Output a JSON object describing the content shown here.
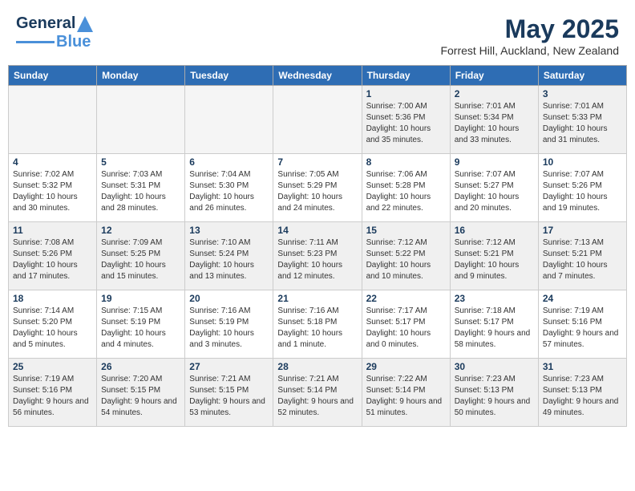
{
  "header": {
    "logo_line1": "General",
    "logo_line2": "Blue",
    "title": "May 2025",
    "subtitle": "Forrest Hill, Auckland, New Zealand"
  },
  "days_of_week": [
    "Sunday",
    "Monday",
    "Tuesday",
    "Wednesday",
    "Thursday",
    "Friday",
    "Saturday"
  ],
  "weeks": [
    [
      {
        "day": "",
        "empty": true
      },
      {
        "day": "",
        "empty": true
      },
      {
        "day": "",
        "empty": true
      },
      {
        "day": "",
        "empty": true
      },
      {
        "day": "1",
        "sunrise": "7:00 AM",
        "sunset": "5:36 PM",
        "daylight": "10 hours and 35 minutes."
      },
      {
        "day": "2",
        "sunrise": "7:01 AM",
        "sunset": "5:34 PM",
        "daylight": "10 hours and 33 minutes."
      },
      {
        "day": "3",
        "sunrise": "7:01 AM",
        "sunset": "5:33 PM",
        "daylight": "10 hours and 31 minutes."
      }
    ],
    [
      {
        "day": "4",
        "sunrise": "7:02 AM",
        "sunset": "5:32 PM",
        "daylight": "10 hours and 30 minutes."
      },
      {
        "day": "5",
        "sunrise": "7:03 AM",
        "sunset": "5:31 PM",
        "daylight": "10 hours and 28 minutes."
      },
      {
        "day": "6",
        "sunrise": "7:04 AM",
        "sunset": "5:30 PM",
        "daylight": "10 hours and 26 minutes."
      },
      {
        "day": "7",
        "sunrise": "7:05 AM",
        "sunset": "5:29 PM",
        "daylight": "10 hours and 24 minutes."
      },
      {
        "day": "8",
        "sunrise": "7:06 AM",
        "sunset": "5:28 PM",
        "daylight": "10 hours and 22 minutes."
      },
      {
        "day": "9",
        "sunrise": "7:07 AM",
        "sunset": "5:27 PM",
        "daylight": "10 hours and 20 minutes."
      },
      {
        "day": "10",
        "sunrise": "7:07 AM",
        "sunset": "5:26 PM",
        "daylight": "10 hours and 19 minutes."
      }
    ],
    [
      {
        "day": "11",
        "sunrise": "7:08 AM",
        "sunset": "5:26 PM",
        "daylight": "10 hours and 17 minutes."
      },
      {
        "day": "12",
        "sunrise": "7:09 AM",
        "sunset": "5:25 PM",
        "daylight": "10 hours and 15 minutes."
      },
      {
        "day": "13",
        "sunrise": "7:10 AM",
        "sunset": "5:24 PM",
        "daylight": "10 hours and 13 minutes."
      },
      {
        "day": "14",
        "sunrise": "7:11 AM",
        "sunset": "5:23 PM",
        "daylight": "10 hours and 12 minutes."
      },
      {
        "day": "15",
        "sunrise": "7:12 AM",
        "sunset": "5:22 PM",
        "daylight": "10 hours and 10 minutes."
      },
      {
        "day": "16",
        "sunrise": "7:12 AM",
        "sunset": "5:21 PM",
        "daylight": "10 hours and 9 minutes."
      },
      {
        "day": "17",
        "sunrise": "7:13 AM",
        "sunset": "5:21 PM",
        "daylight": "10 hours and 7 minutes."
      }
    ],
    [
      {
        "day": "18",
        "sunrise": "7:14 AM",
        "sunset": "5:20 PM",
        "daylight": "10 hours and 5 minutes."
      },
      {
        "day": "19",
        "sunrise": "7:15 AM",
        "sunset": "5:19 PM",
        "daylight": "10 hours and 4 minutes."
      },
      {
        "day": "20",
        "sunrise": "7:16 AM",
        "sunset": "5:19 PM",
        "daylight": "10 hours and 3 minutes."
      },
      {
        "day": "21",
        "sunrise": "7:16 AM",
        "sunset": "5:18 PM",
        "daylight": "10 hours and 1 minute."
      },
      {
        "day": "22",
        "sunrise": "7:17 AM",
        "sunset": "5:17 PM",
        "daylight": "10 hours and 0 minutes."
      },
      {
        "day": "23",
        "sunrise": "7:18 AM",
        "sunset": "5:17 PM",
        "daylight": "9 hours and 58 minutes."
      },
      {
        "day": "24",
        "sunrise": "7:19 AM",
        "sunset": "5:16 PM",
        "daylight": "9 hours and 57 minutes."
      }
    ],
    [
      {
        "day": "25",
        "sunrise": "7:19 AM",
        "sunset": "5:16 PM",
        "daylight": "9 hours and 56 minutes."
      },
      {
        "day": "26",
        "sunrise": "7:20 AM",
        "sunset": "5:15 PM",
        "daylight": "9 hours and 54 minutes."
      },
      {
        "day": "27",
        "sunrise": "7:21 AM",
        "sunset": "5:15 PM",
        "daylight": "9 hours and 53 minutes."
      },
      {
        "day": "28",
        "sunrise": "7:21 AM",
        "sunset": "5:14 PM",
        "daylight": "9 hours and 52 minutes."
      },
      {
        "day": "29",
        "sunrise": "7:22 AM",
        "sunset": "5:14 PM",
        "daylight": "9 hours and 51 minutes."
      },
      {
        "day": "30",
        "sunrise": "7:23 AM",
        "sunset": "5:13 PM",
        "daylight": "9 hours and 50 minutes."
      },
      {
        "day": "31",
        "sunrise": "7:23 AM",
        "sunset": "5:13 PM",
        "daylight": "9 hours and 49 minutes."
      }
    ]
  ]
}
